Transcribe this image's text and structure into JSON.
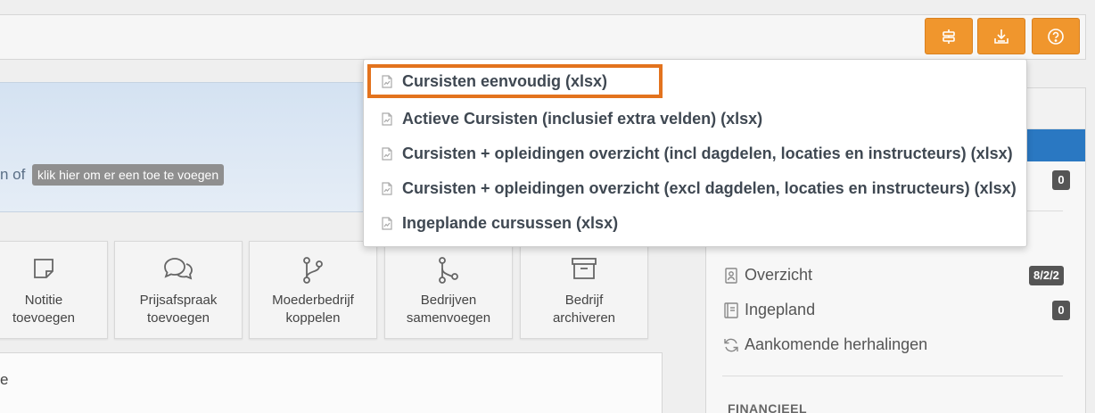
{
  "toolbar": {
    "buttons": [
      {
        "name": "settings",
        "icon": "sliders-icon"
      },
      {
        "name": "export",
        "icon": "download-icon"
      },
      {
        "name": "help",
        "icon": "help-circle-icon"
      }
    ],
    "accent": "#f0962d"
  },
  "info": {
    "text": "n of",
    "link": "klik hier om er een toe te voegen"
  },
  "actions": [
    {
      "line1": "Notitie",
      "line2": "toevoegen",
      "icon": "note-icon"
    },
    {
      "line1": "Prijsafspraak",
      "line2": "toevoegen",
      "icon": "chat-icon"
    },
    {
      "line1": "Moederbedrijf",
      "line2": "koppelen",
      "icon": "branch-icon"
    },
    {
      "line1": "Bedrijven",
      "line2": "samenvoegen",
      "icon": "merge-icon"
    },
    {
      "line1": "Bedrijf",
      "line2": "archiveren",
      "icon": "archive-icon"
    }
  ],
  "bottom_panel": {
    "title": "e"
  },
  "dropdown": {
    "items": [
      {
        "label": "Cursisten eenvoudig (xlsx)",
        "selected": true
      },
      {
        "label": "Actieve Cursisten (inclusief extra velden) (xlsx)"
      },
      {
        "label": "Cursisten + opleidingen overzicht (incl dagdelen, locaties en instructeurs) (xlsx)"
      },
      {
        "label": "Cursisten + opleidingen overzicht (excl dagdelen, locaties en instructeurs) (xlsx)"
      },
      {
        "label": "Ingeplande cursussen (xlsx)"
      }
    ],
    "highlight_color": "#e3731e"
  },
  "sidebar": {
    "top_badge": "0",
    "items": [
      {
        "label": "Overzicht",
        "badge": "8/2/2",
        "icon": "id-card-icon"
      },
      {
        "label": "Ingepland",
        "badge": "0",
        "icon": "book-icon"
      },
      {
        "label": "Aankomende herhalingen",
        "badge": "",
        "icon": "refresh-icon"
      }
    ],
    "section": "FINANCIEEL",
    "accent": "#2a78c2"
  }
}
